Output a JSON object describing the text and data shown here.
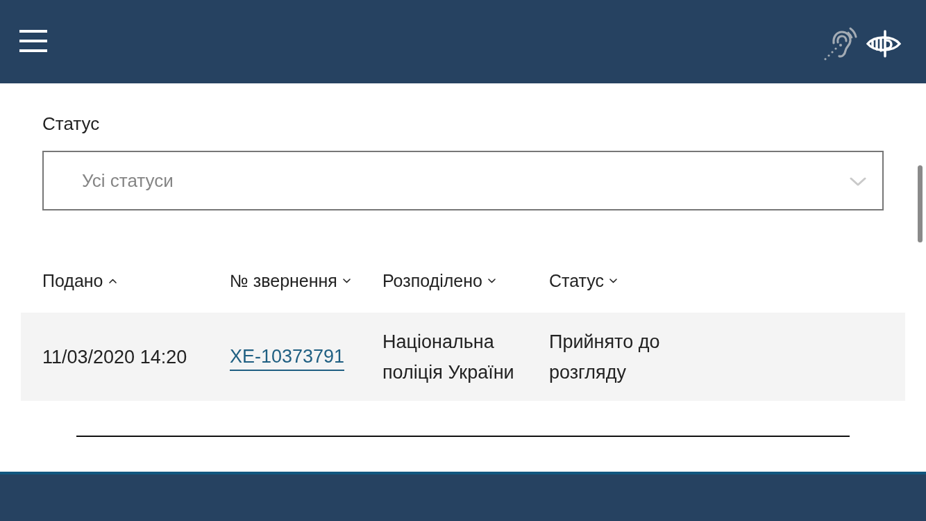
{
  "filter": {
    "label": "Статус",
    "placeholder": "Усі статуси"
  },
  "table": {
    "columns": [
      {
        "label": "Подано",
        "sort_ascending": true
      },
      {
        "label": "№ звернення",
        "sort_ascending": false
      },
      {
        "label": "Розподілено",
        "sort_ascending": false
      },
      {
        "label": "Статус",
        "sort_ascending": false
      }
    ],
    "rows": [
      {
        "cells": [
          {
            "kind": "text",
            "text": "11/03/2020 14:20"
          },
          {
            "kind": "link",
            "text": "XE-10373791"
          },
          {
            "kind": "text",
            "text": "Національна поліція України"
          },
          {
            "kind": "text",
            "text": "Прийнято до розгляду"
          }
        ]
      }
    ]
  }
}
